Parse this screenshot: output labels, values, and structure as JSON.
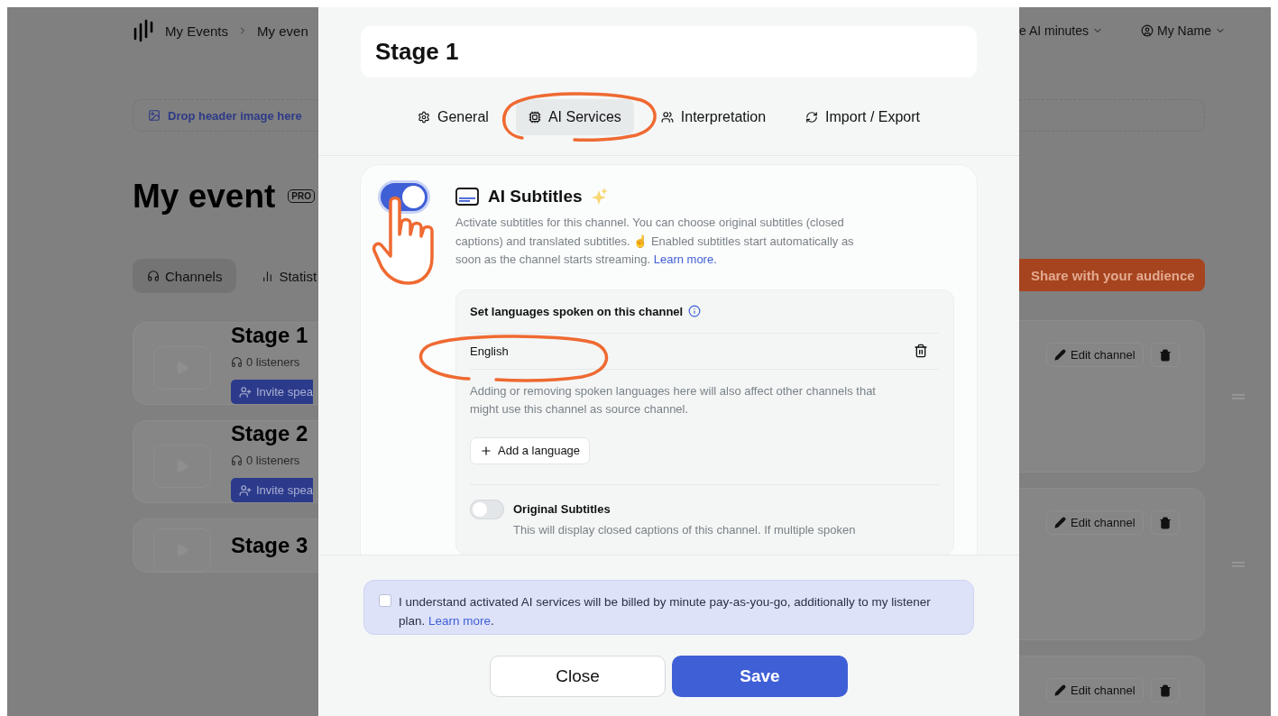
{
  "background_page": {
    "breadcrumb": [
      "My Events",
      "My even"
    ],
    "header_menus": [
      "e AI minutes",
      "My Name"
    ],
    "drop_header": "Drop header image here",
    "event_title": "My event",
    "badge": "PRO",
    "tabs": [
      {
        "label": "Channels",
        "selected": true
      },
      {
        "label": "Statist",
        "selected": false
      }
    ],
    "share_button": "Share with your audience",
    "channels": [
      {
        "name": "Stage 1",
        "listeners": "0 listeners",
        "invite": "Invite spea",
        "edit": "Edit channel"
      },
      {
        "name": "Stage 2",
        "listeners": "0 listeners",
        "invite": "Invite spea",
        "edit": "Edit channel"
      },
      {
        "name": "Stage 3",
        "edit": "Edit channel"
      }
    ]
  },
  "modal": {
    "title": "Stage 1",
    "tabs": [
      {
        "label": "General",
        "selected": false
      },
      {
        "label": "AI Services",
        "selected": true
      },
      {
        "label": "Interpretation",
        "selected": false
      },
      {
        "label": "Import / Export",
        "selected": false
      }
    ],
    "ai_subtitles": {
      "on": true,
      "title": "AI Subtitles",
      "description": "Activate subtitles for this channel. You can choose original subtitles (closed captions) and translated subtitles. ☝️ Enabled subtitles start automatically as soon as the channel starts streaming.",
      "link": "Learn more."
    },
    "languages": {
      "title": "Set languages spoken on this channel",
      "items": [
        "English"
      ],
      "note": "Adding or removing spoken languages here will also affect other channels that might use this channel as source channel.",
      "add_button": "Add a language"
    },
    "original_subtitles": {
      "on": false,
      "title": "Original Subtitles",
      "description": "This will display closed captions of this channel. If multiple spoken"
    },
    "consent": {
      "checked": false,
      "text": "I understand activated AI services will be billed by minute pay-as-you-go, additionally to my listener plan. ",
      "link": "Learn more",
      "suffix": "."
    },
    "buttons": {
      "close": "Close",
      "save": "Save"
    }
  }
}
